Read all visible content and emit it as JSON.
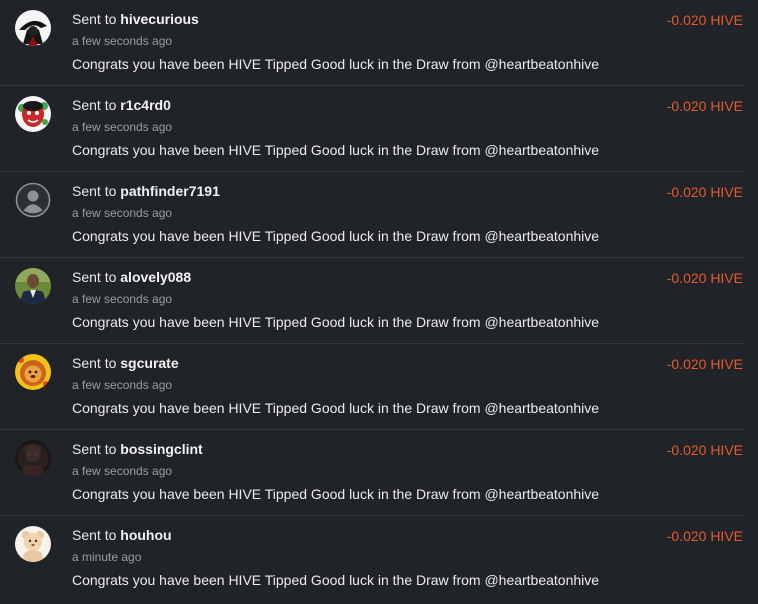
{
  "transfers": [
    {
      "prefix": "Sent to",
      "user": "hivecurious",
      "time": "a few seconds ago",
      "memo": "Congrats you have been HIVE Tipped Good luck in the Draw from @heartbeatonhive",
      "amount": "-0.020 HIVE",
      "avatar_icon": "masked-figure-avatar-icon"
    },
    {
      "prefix": "Sent to",
      "user": "r1c4rd0",
      "time": "a few seconds ago",
      "memo": "Congrats you have been HIVE Tipped Good luck in the Draw from @heartbeatonhive",
      "amount": "-0.020 HIVE",
      "avatar_icon": "red-face-avatar-icon"
    },
    {
      "prefix": "Sent to",
      "user": "pathfinder7191",
      "time": "a few seconds ago",
      "memo": "Congrats you have been HIVE Tipped Good luck in the Draw from @heartbeatonhive",
      "amount": "-0.020 HIVE",
      "avatar_icon": "default-user-avatar-icon"
    },
    {
      "prefix": "Sent to",
      "user": "alovely088",
      "time": "a few seconds ago",
      "memo": "Congrats you have been HIVE Tipped Good luck in the Draw from @heartbeatonhive",
      "amount": "-0.020 HIVE",
      "avatar_icon": "man-in-suit-avatar-icon"
    },
    {
      "prefix": "Sent to",
      "user": "sgcurate",
      "time": "a few seconds ago",
      "memo": "Congrats you have been HIVE Tipped Good luck in the Draw from @heartbeatonhive",
      "amount": "-0.020 HIVE",
      "avatar_icon": "lion-cartoon-avatar-icon"
    },
    {
      "prefix": "Sent to",
      "user": "bossingclint",
      "time": "a few seconds ago",
      "memo": "Congrats you have been HIVE Tipped Good luck in the Draw from @heartbeatonhive",
      "amount": "-0.020 HIVE",
      "avatar_icon": "dark-warrior-avatar-icon"
    },
    {
      "prefix": "Sent to",
      "user": "houhou",
      "time": "a minute ago",
      "memo": "Congrats you have been HIVE Tipped Good luck in the Draw from @heartbeatonhive",
      "amount": "-0.020 HIVE",
      "avatar_icon": "teddy-bear-avatar-icon"
    }
  ],
  "colors": {
    "background": "#202327",
    "divider": "#33363b",
    "amount_negative": "#e45a2e",
    "muted_text": "#9a9da3"
  }
}
